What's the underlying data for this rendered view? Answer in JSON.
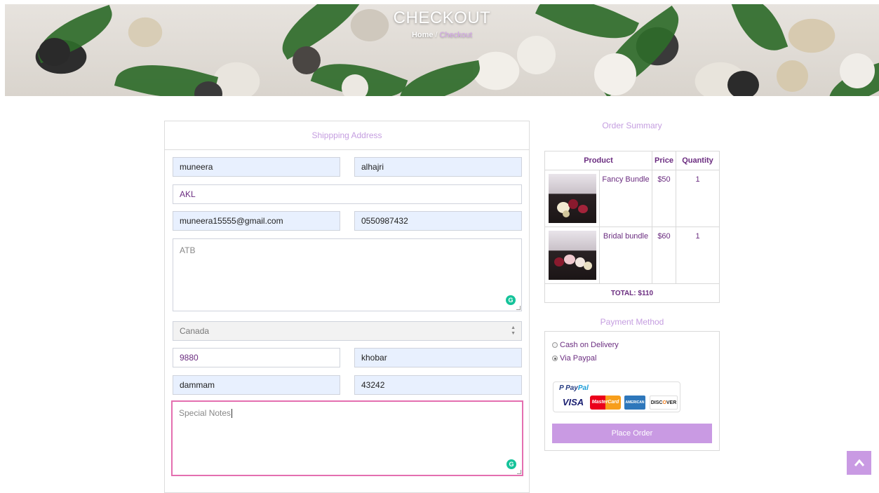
{
  "hero": {
    "title": "CHECKOUT",
    "breadcrumb": {
      "home": "Home",
      "separator": "/",
      "current": "Checkout"
    }
  },
  "shipping": {
    "title": "Shippping Address",
    "first_name": "muneera",
    "last_name": "alhajri",
    "company": "AKL",
    "email": "muneera15555@gmail.com",
    "phone": "0550987432",
    "address": "ATB",
    "country": "Canada",
    "postcode": "9880",
    "city": "khobar",
    "state": "dammam",
    "zip": "43242",
    "notes_placeholder": "Special Notes"
  },
  "order_summary": {
    "title": "Order Summary",
    "columns": [
      "Product",
      "Price",
      "Quantity"
    ],
    "items": [
      {
        "name": "Fancy Bundle",
        "price": "$50",
        "quantity": "1"
      },
      {
        "name": "Bridal bundle",
        "price": "$60",
        "quantity": "1"
      }
    ],
    "total": "TOTAL: $110"
  },
  "payment": {
    "title": "Payment Method",
    "options": [
      {
        "label": "Cash on Delivery",
        "selected": false
      },
      {
        "label": "Via Paypal",
        "selected": true
      }
    ],
    "paypal_label": "PayPal",
    "place_order": "Place Order"
  },
  "icons": {
    "grammarly": "grammarly-icon",
    "scroll_top": "chevron-up-icon"
  },
  "colors": {
    "accent": "#c99ae3",
    "heading": "#c59ee0",
    "text_purple": "#6b2d80",
    "focus_border": "#e46fb0"
  }
}
